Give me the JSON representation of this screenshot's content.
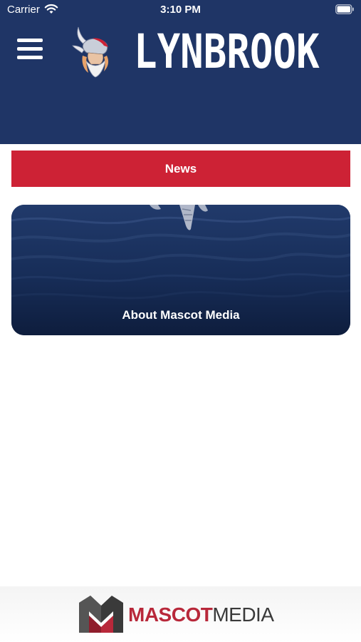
{
  "status_bar": {
    "carrier": "Carrier",
    "time": "3:10 PM"
  },
  "header": {
    "brand": "LYNBROOK",
    "menu_icon": "hamburger-menu-icon",
    "logo_icon": "viking-mascot-logo"
  },
  "news_button": {
    "label": "News"
  },
  "about_card": {
    "label": "About Mascot Media"
  },
  "footer": {
    "brand_part1": "MASCOT",
    "brand_part2": "MEDIA"
  },
  "colors": {
    "header_bg": "#1f3566",
    "news_red": "#cd2235",
    "card_navy": "#13254b",
    "footer_red": "#b8283a"
  }
}
